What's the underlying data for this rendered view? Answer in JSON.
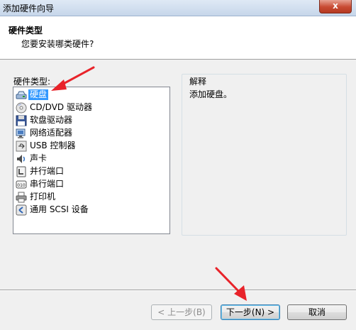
{
  "window": {
    "title": "添加硬件向导",
    "close_glyph": "x"
  },
  "header": {
    "title": "硬件类型",
    "subtitle": "您要安装哪类硬件?"
  },
  "hardware_list": {
    "label": "硬件类型:",
    "items": [
      {
        "label": "硬盘",
        "icon": "hard-disk-icon",
        "selected": true
      },
      {
        "label": "CD/DVD 驱动器",
        "icon": "cd-dvd-icon",
        "selected": false
      },
      {
        "label": "软盘驱动器",
        "icon": "floppy-icon",
        "selected": false
      },
      {
        "label": "网络适配器",
        "icon": "network-adapter-icon",
        "selected": false
      },
      {
        "label": "USB 控制器",
        "icon": "usb-icon",
        "selected": false
      },
      {
        "label": "声卡",
        "icon": "speaker-icon",
        "selected": false
      },
      {
        "label": "并行端口",
        "icon": "parallel-port-icon",
        "selected": false
      },
      {
        "label": "串行端口",
        "icon": "serial-port-icon",
        "selected": false
      },
      {
        "label": "打印机",
        "icon": "printer-icon",
        "selected": false
      },
      {
        "label": "通用 SCSI 设备",
        "icon": "scsi-icon",
        "selected": false
      }
    ]
  },
  "description": {
    "title": "解释",
    "text": "添加硬盘。"
  },
  "buttons": {
    "back": "< 上一步(B)",
    "next": "下一步(N) >",
    "cancel": "取消"
  },
  "colors": {
    "selection": "#3399ff",
    "annotation_arrow": "#e8232a"
  }
}
